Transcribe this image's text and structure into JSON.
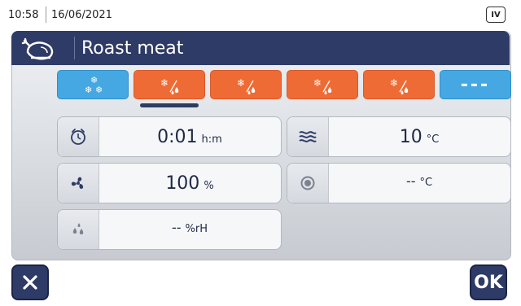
{
  "status": {
    "time": "10:58",
    "date": "16/06/2021",
    "level_badge": "IV"
  },
  "program": {
    "title": "Roast meat",
    "icon": "roast-chicken-icon"
  },
  "phases": [
    {
      "type": "chill",
      "icon": "snowflake-icon",
      "color": "#45a8e3"
    },
    {
      "type": "cold-humid",
      "icon": "snowflake-drop-icon",
      "color": "#ef6b35",
      "selected": true
    },
    {
      "type": "cold-humid",
      "icon": "snowflake-drop-icon",
      "color": "#ef6b35"
    },
    {
      "type": "cold-humid",
      "icon": "snowflake-drop-icon",
      "color": "#ef6b35"
    },
    {
      "type": "cold-humid",
      "icon": "snowflake-drop-icon",
      "color": "#ef6b35"
    },
    {
      "type": "empty",
      "label": "---",
      "color": "#45a8e3"
    }
  ],
  "params": {
    "time": {
      "value": "0:01",
      "unit": "h:m",
      "icon": "timer-icon"
    },
    "air_temp": {
      "value": "10",
      "unit": "°C",
      "icon": "air-temperature-icon"
    },
    "fan": {
      "value": "100",
      "unit": "%",
      "icon": "fan-icon"
    },
    "core_temp": {
      "value": "--",
      "unit": "°C",
      "icon": "core-probe-icon"
    },
    "humidity": {
      "value": "--",
      "unit": "%rH",
      "icon": "humidity-icon"
    }
  },
  "buttons": {
    "cancel_icon": "close-icon",
    "ok_label": "OK"
  },
  "colors": {
    "header": "#2e3b66",
    "orange": "#ef6b35",
    "blue": "#45a8e3"
  }
}
